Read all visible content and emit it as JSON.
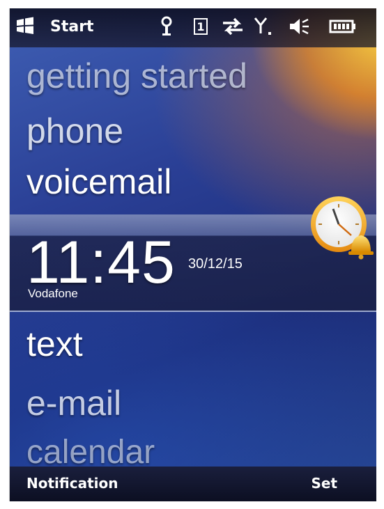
{
  "status_bar": {
    "start_label": "Start",
    "icons": [
      "windows-flag-icon",
      "antenna-icon",
      "sim-slot-icon",
      "data-transfer-icon",
      "signal-strength-icon",
      "speaker-muted-icon",
      "battery-icon"
    ],
    "sim_number": "1"
  },
  "home": {
    "menu_items": [
      "getting started",
      "phone",
      "voicemail",
      "text",
      "e-mail",
      "calendar"
    ],
    "clock": {
      "time": "11:45",
      "date": "30/12/15"
    },
    "operator": "Vodafone",
    "alarm_icon": "alarm-clock-icon"
  },
  "softkeys": {
    "left": "Notification",
    "right": "Set"
  },
  "colors": {
    "accent_orange": "#f5a623",
    "background_blue": "#2a3f95",
    "softkey_bar": "#12162e"
  }
}
